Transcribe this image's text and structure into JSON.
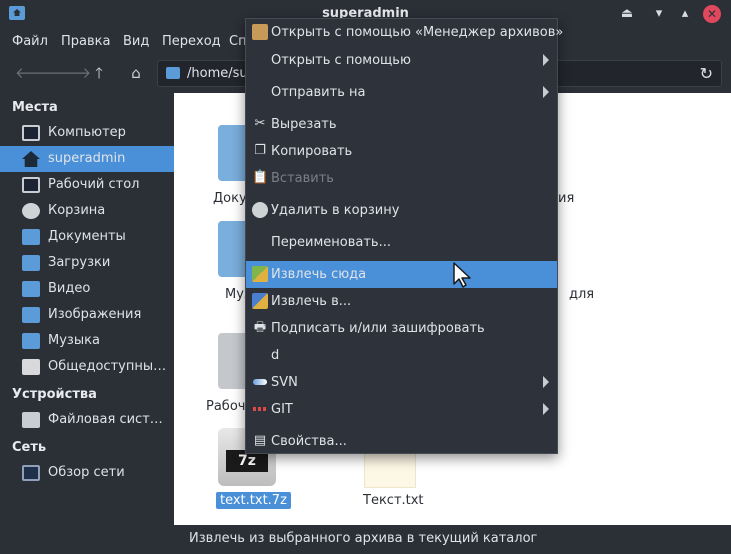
{
  "window": {
    "title": "superadmin"
  },
  "menubar": {
    "items": [
      "Файл",
      "Правка",
      "Вид",
      "Переход",
      "Сп"
    ]
  },
  "toolbar": {
    "path": "/home/su"
  },
  "sidebar": {
    "places_header": "Места",
    "devices_header": "Устройства",
    "network_header": "Сеть",
    "places": [
      {
        "label": "Компьютер",
        "icon": "computer-icon"
      },
      {
        "label": "superadmin",
        "icon": "home-icon"
      },
      {
        "label": "Рабочий стол",
        "icon": "desktop-icon"
      },
      {
        "label": "Корзина",
        "icon": "trash-icon"
      },
      {
        "label": "Документы",
        "icon": "folder-documents-icon"
      },
      {
        "label": "Загрузки",
        "icon": "folder-downloads-icon"
      },
      {
        "label": "Видео",
        "icon": "folder-video-icon"
      },
      {
        "label": "Изображения",
        "icon": "folder-pictures-icon"
      },
      {
        "label": "Музыка",
        "icon": "folder-music-icon"
      },
      {
        "label": "Общедоступные ...",
        "icon": "folder-public-icon"
      }
    ],
    "devices": [
      {
        "label": "Файловая система",
        "icon": "harddisk-icon"
      }
    ],
    "network": [
      {
        "label": "Обзор сети",
        "icon": "network-icon"
      }
    ]
  },
  "files": [
    {
      "label": "Доку",
      "partial": true
    },
    {
      "label": "ия",
      "partial": true
    },
    {
      "label": "Муз",
      "partial": true
    },
    {
      "label": "для",
      "partial": true
    },
    {
      "label": "Рабоч",
      "partial": true
    },
    {
      "label": "text.txt.7z",
      "selected": true
    },
    {
      "label": "Текст.txt"
    }
  ],
  "context_menu": {
    "items": [
      {
        "label": "Открыть с помощью «Менеджер архивов»",
        "icon": "archive-manager-icon"
      },
      {
        "label": "Открыть с помощью",
        "submenu": true
      },
      {
        "label": "Отправить на",
        "submenu": true
      },
      {
        "label": "Вырезать",
        "icon": "scissors-icon"
      },
      {
        "label": "Копировать",
        "icon": "copy-icon"
      },
      {
        "label": "Вставить",
        "icon": "paste-icon",
        "disabled": true
      },
      {
        "label": "Удалить в корзину",
        "icon": "trash-icon"
      },
      {
        "label": "Переименовать..."
      },
      {
        "label": "Извлечь сюда",
        "icon": "extract-here-icon",
        "active": true
      },
      {
        "label": "Извлечь в...",
        "icon": "extract-to-icon"
      },
      {
        "label": "Подписать и/или зашифровать",
        "icon": "encrypt-icon"
      },
      {
        "label": "d"
      },
      {
        "label": "SVN",
        "icon": "svn-icon",
        "submenu": true
      },
      {
        "label": "GIT",
        "icon": "git-icon",
        "submenu": true
      },
      {
        "label": "Свойства...",
        "icon": "properties-icon"
      }
    ]
  },
  "statusbar": {
    "text": "Извлечь из выбранного архива в текущий каталог"
  },
  "colors": {
    "accent": "#4a90d9",
    "background": "#2b2f36",
    "close": "#e0495d"
  }
}
